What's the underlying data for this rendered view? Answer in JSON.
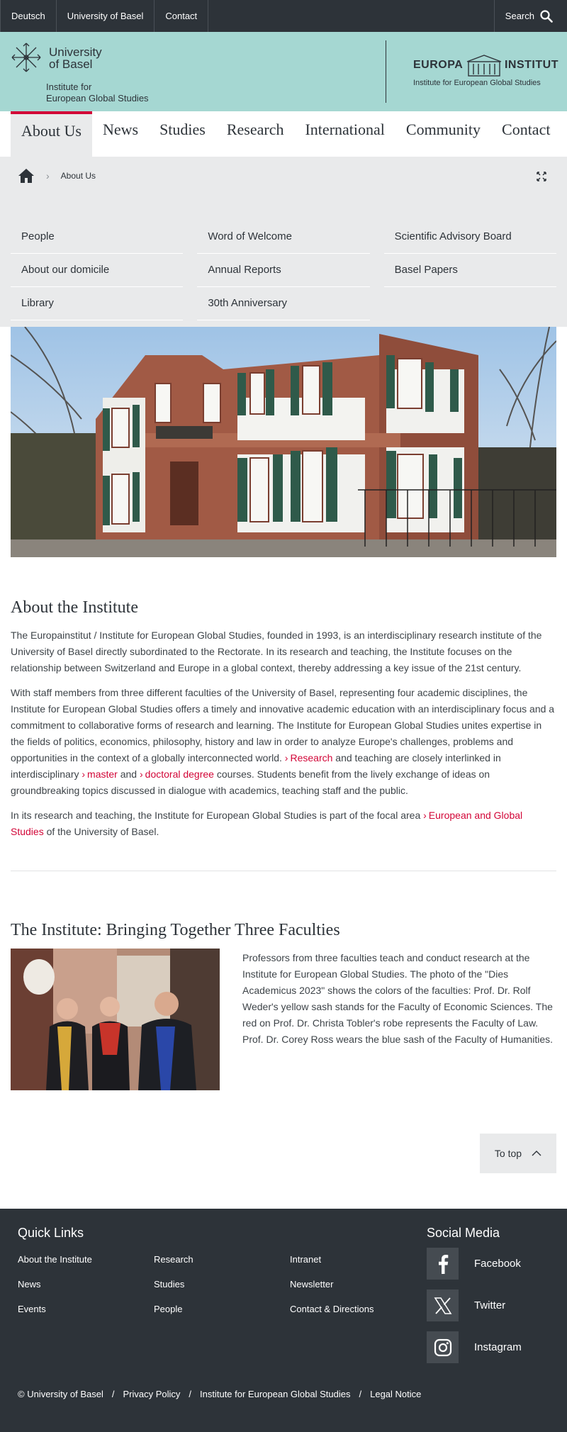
{
  "topbar": {
    "links": [
      "Deutsch",
      "University of Basel",
      "Contact"
    ],
    "search_label": "Search"
  },
  "header": {
    "university_name_line1": "University",
    "university_name_line2": "of Basel",
    "institute_line1": "Institute for",
    "institute_line2": "European Global Studies",
    "europa_left": "EUROPA",
    "europa_right": "INSTITUT",
    "europa_sub": "Institute for European Global Studies"
  },
  "mainnav": [
    "About Us",
    "News",
    "Studies",
    "Research",
    "International",
    "Community",
    "Contact"
  ],
  "breadcrumb": {
    "current": "About Us"
  },
  "subnav": [
    "People",
    "Word of Welcome",
    "Scientific Advisory Board",
    "About our domicile",
    "Annual Reports",
    "Basel Papers",
    "Library",
    "30th Anniversary"
  ],
  "about": {
    "title": "About the Institute",
    "p1": "The Europainstitut / Institute for European Global Studies, founded in 1993, is an interdisciplinary research institute of the University of Basel directly subordinated to the Rectorate. In its research and teaching, the Institute focuses on the relationship between Switzerland and Europe in a global context, thereby addressing a key issue of the 21st century.",
    "p2_a": "With staff members from three different faculties of the University of Basel, representing four academic disciplines, the Institute for European Global Studies offers a timely and innovative academic education with an interdisciplinary focus and a commitment to collaborative forms of research and learning. The Institute for European Global Studies unites expertise in the fields of politics, economics, philosophy, history and law in order to analyze Europe's challenges, problems and opportunities in the context of a globally interconnected world.",
    "link_research": "Research",
    "p2_b": "and teaching are closely interlinked in interdisciplinary",
    "link_master": "master",
    "p2_and": "and",
    "link_doctoral": "doctoral degree",
    "p2_c": "courses. Students benefit from the lively exchange of ideas on groundbreaking topics discussed in dialogue with academics, teaching staff and the public.",
    "p3_a": "In its research and teaching, the Institute for European Global Studies is part of the focal area",
    "link_focal": "European and Global Studies",
    "p3_b": "of the University of Basel."
  },
  "faculties": {
    "title": "The Institute: Bringing Together Three Faculties",
    "text": "Professors from three faculties teach and conduct research at the Institute for European Global Studies. The photo of the \"Dies Academicus 2023\" shows the colors of the faculties: Prof. Dr. Rolf Weder's yellow sash stands for the Faculty of Economic Sciences. The red on Prof. Dr. Christa Tobler's robe represents the Faculty of Law. Prof. Dr. Corey Ross wears the blue sash of the Faculty of Humanities."
  },
  "totop_label": "To top",
  "footer": {
    "quick_links_title": "Quick Links",
    "quick_links": [
      "About the Institute",
      "Research",
      "Intranet",
      "News",
      "Studies",
      "Newsletter",
      "Events",
      "People",
      "Contact & Directions"
    ],
    "social_title": "Social Media",
    "social": [
      {
        "label": "Facebook",
        "icon": "facebook-icon"
      },
      {
        "label": "Twitter",
        "icon": "x-twitter-icon"
      },
      {
        "label": "Instagram",
        "icon": "instagram-icon"
      }
    ],
    "legal": [
      "© University of Basel",
      "/",
      "Privacy Policy",
      "/",
      "Institute for European Global Studies",
      "/",
      "Legal Notice"
    ]
  },
  "colors": {
    "accent": "#d20537",
    "mint": "#a5d7d2",
    "dark": "#2d3339",
    "panel": "#e9eaeb"
  }
}
